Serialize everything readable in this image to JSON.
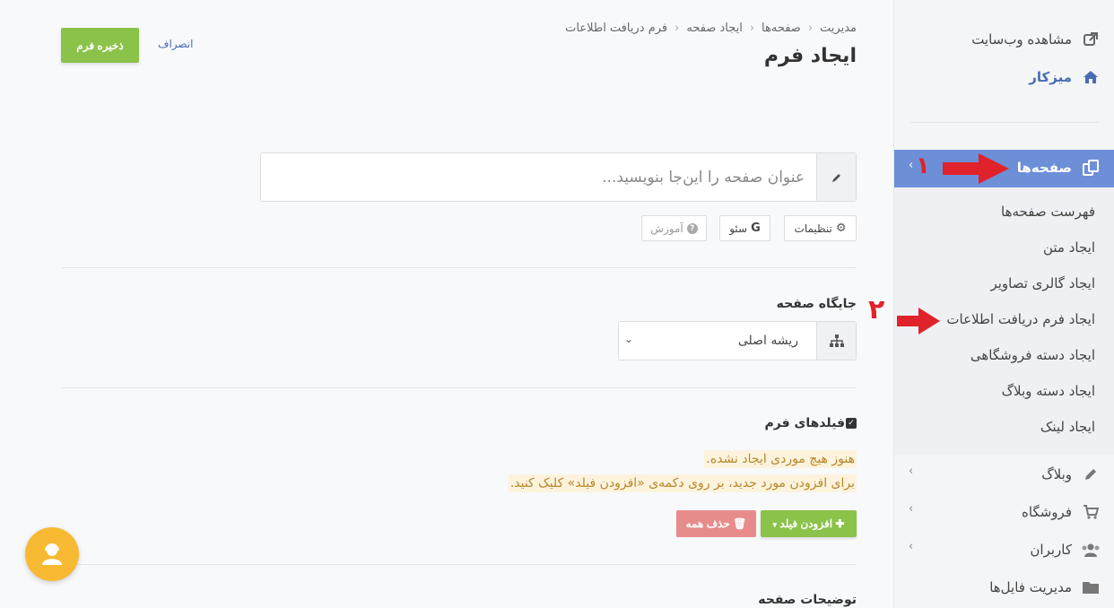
{
  "sidebar": {
    "top": [
      {
        "label": "مشاهده وب‌سایت",
        "icon": "external-link-icon"
      },
      {
        "label": "میزکار",
        "icon": "home-icon"
      }
    ],
    "active": {
      "label": "صفحه‌ها",
      "icon": "pages-icon"
    },
    "submenu": [
      "فهرست صفحه‌ها",
      "ایجاد متن",
      "ایجاد گالری تصاویر",
      "ایجاد فرم دریافت اطلاعات",
      "ایجاد دسته فروشگاهی",
      "ایجاد دسته وبلاگ",
      "ایجاد لینک"
    ],
    "bottom": [
      {
        "label": "وبلاگ",
        "icon": "pencil-icon"
      },
      {
        "label": "فروشگاه",
        "icon": "cart-icon"
      },
      {
        "label": "کاربران",
        "icon": "users-icon"
      },
      {
        "label": "مدیریت فایل‌ها",
        "icon": "folder-icon"
      }
    ]
  },
  "annotations": {
    "one": "۱",
    "two": "۲"
  },
  "breadcrumb": [
    "مدیریت",
    "صفحه‌ها",
    "ایجاد صفحه",
    "فرم دریافت اطلاعات"
  ],
  "page_title": "ایجاد فرم",
  "actions": {
    "save": "ذخیره فرم",
    "cancel": "انصراف"
  },
  "title_input": {
    "placeholder": "عنوان صفحه را این‌جا بنویسید...",
    "value": ""
  },
  "tool_buttons": {
    "settings": "تنظیمات",
    "seo": "سئو",
    "help": "آموزش"
  },
  "placement": {
    "label": "جایگاه صفحه",
    "value": "ریشه اصلی"
  },
  "form_fields": {
    "label": "فیلدهای فرم",
    "empty_line1": "هنوز هیچ موردی ایجاد نشده.",
    "empty_line2": "برای افزودن مورد جدید، بر روی دکمه‌ی «افزودن فیلد» کلیک کنید.",
    "add_button": "افزودن فیلد",
    "delete_button": "حذف همه"
  },
  "description": {
    "label": "توضیحات صفحه"
  },
  "colors": {
    "accent": "#6d8fd8",
    "primary_green": "#8bc34a",
    "danger": "#e88b8b",
    "warning_text": "#b7872a",
    "annotation_red": "#e0222a"
  }
}
